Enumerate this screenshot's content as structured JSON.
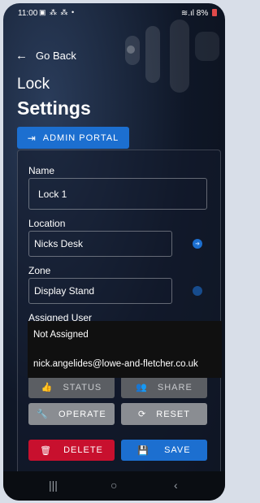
{
  "status_bar": {
    "time": "11:00",
    "left_icons": "▣ ⁂ ⁂ •",
    "signal": "≋.ıl",
    "battery": "8%"
  },
  "nav": {
    "go_back": "Go Back"
  },
  "title": {
    "line1": "Lock",
    "line2": "Settings"
  },
  "admin_portal": {
    "label": "ADMIN PORTAL"
  },
  "form": {
    "name_label": "Name",
    "name_value": "Lock 1",
    "location_label": "Location",
    "location_value": "Nicks Desk",
    "zone_label": "Zone",
    "zone_value": "Display Stand",
    "assigned_user_label": "Assigned User"
  },
  "dropdown": {
    "options": [
      "Not Assigned",
      "nick.angelides@lowe-and-fletcher.co.uk"
    ]
  },
  "buttons": {
    "status": "STATUS",
    "share": "SHARE",
    "operate": "OPERATE",
    "reset": "RESET",
    "delete": "DELETE",
    "save": "SAVE"
  },
  "icons": {
    "back": "arrow-left-icon",
    "admin": "login-icon",
    "status": "thumbs-icon",
    "share": "people-icon",
    "operate": "wrench-icon",
    "reset": "refresh-icon",
    "delete": "trash-icon",
    "save": "save-icon"
  },
  "colors": {
    "primary": "#1c6fd0",
    "danger": "#c8102e",
    "neutral": "#8a8d92"
  }
}
